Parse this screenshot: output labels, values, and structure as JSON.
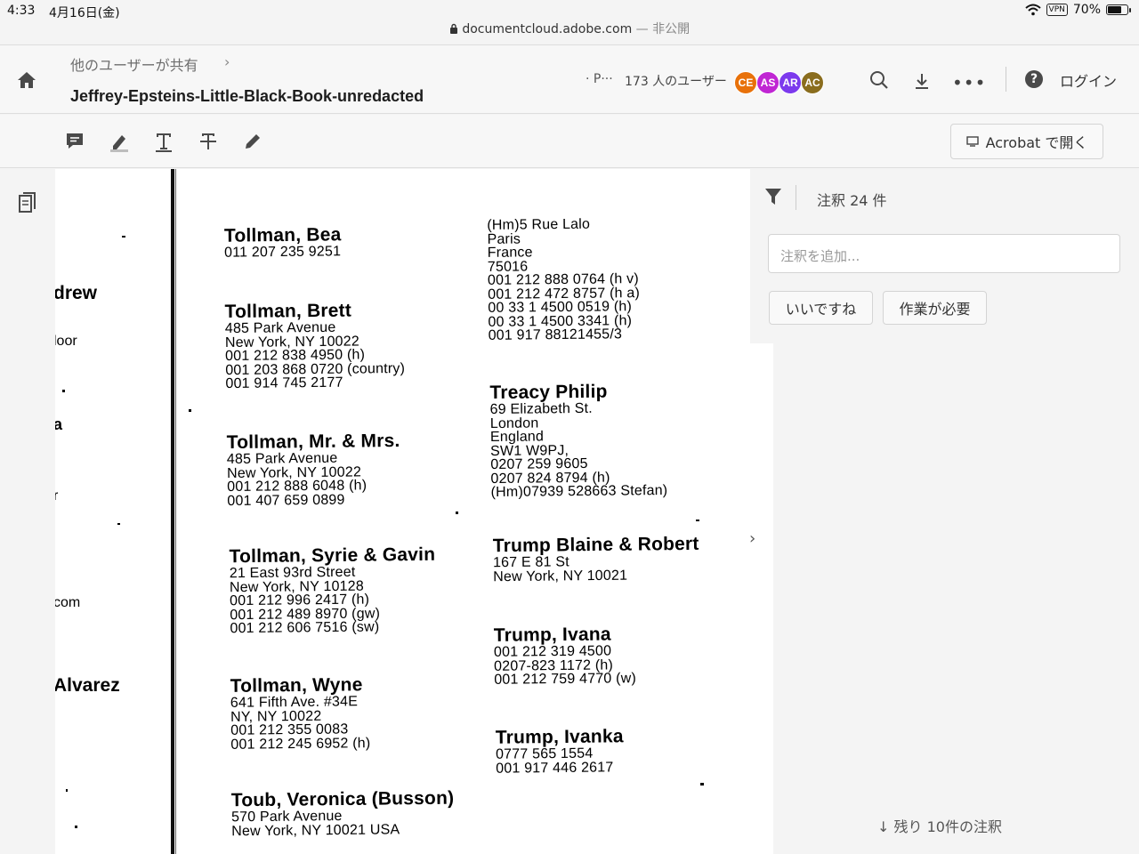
{
  "status": {
    "time": "4:33",
    "date": "4月16日(金)",
    "vpn": "VPN",
    "battery": "70%"
  },
  "browser": {
    "url": "documentcloud.adobe.com",
    "visibility": "— 非公開"
  },
  "header": {
    "breadcrumb": "他のユーザーが共有",
    "breadcrumb_chevron": "›",
    "title": "Jeffrey-Epsteins-Little-Black-Book-unredacted",
    "presence": "· P···",
    "users": "173 人のユーザー",
    "avatars": [
      {
        "initials": "CE",
        "color": "#e8710a"
      },
      {
        "initials": "AS",
        "color": "#c026d3"
      },
      {
        "initials": "AR",
        "color": "#7c3aed"
      },
      {
        "initials": "AC",
        "color": "#8a6d1e"
      }
    ],
    "more": "•••",
    "help": "?",
    "login": "ログイン"
  },
  "toolbar": {
    "open_in_acrobat": "Acrobat で開く"
  },
  "comments": {
    "count": "注釈 24 件",
    "input_placeholder": "注釈を追加...",
    "chips": [
      "いいですね",
      "作業が必要"
    ],
    "remaining": "残り 10件の注釈"
  },
  "document": {
    "left_fragments": [
      "drew",
      "loor",
      "a",
      "r",
      "com",
      "Alvarez"
    ],
    "next_page": "›",
    "left_column": [
      {
        "name": "Tollman, Bea",
        "lines": [
          "011 207 235 9251"
        ]
      },
      {
        "name": "Tollman, Brett",
        "lines": [
          "485 Park Avenue",
          "New York, NY 10022",
          "001 212 838 4950 (h)",
          "001 203 868 0720 (country)",
          "001 914 745 2177"
        ]
      },
      {
        "name": "Tollman, Mr. & Mrs.",
        "lines": [
          "485 Park Avenue",
          "New York, NY 10022",
          "001 212 888 6048 (h)",
          "001 407 659 0899"
        ]
      },
      {
        "name": "Tollman, Syrie & Gavin",
        "lines": [
          "21 East 93rd Street",
          "New York, NY 10128",
          "001 212 996 2417 (h)",
          "001 212 489 8970 (gw)",
          "001 212 606 7516 (sw)"
        ]
      },
      {
        "name": "Tollman, Wyne",
        "lines": [
          "641 Fifth Ave. #34E",
          "NY, NY 10022",
          "001 212 355 0083",
          "001 212 245 6952 (h)"
        ]
      },
      {
        "name": "Toub, Veronica (Busson)",
        "lines": [
          "570 Park Avenue",
          "New York, NY 10021 USA"
        ]
      }
    ],
    "right_column": [
      {
        "name": "",
        "lines": [
          "(Hm)5 Rue Lalo",
          "Paris",
          "France",
          "75016",
          "001 212 888 0764 (h v)",
          "001 212 472 8757 (h a)",
          "00 33 1 4500 0519 (h)",
          "00 33 1 4500 3341 (h)",
          "001 917 88121455/3"
        ]
      },
      {
        "name": "Treacy Philip",
        "lines": [
          "69 Elizabeth St.",
          "London",
          "England",
          "SW1 W9PJ,",
          "0207 259 9605",
          "0207 824 8794 (h)",
          "(Hm)07939 528663 Stefan)"
        ]
      },
      {
        "name": "Trump Blaine & Robert",
        "lines": [
          "167 E 81 St",
          "New York, NY 10021"
        ]
      },
      {
        "name": "Trump, Ivana",
        "lines": [
          "001 212 319 4500",
          "0207-823 1172 (h)",
          "001 212 759 4770 (w)"
        ]
      },
      {
        "name": "Trump, Ivanka",
        "lines": [
          "0777 565 1554",
          "001 917 446 2617"
        ]
      }
    ]
  }
}
